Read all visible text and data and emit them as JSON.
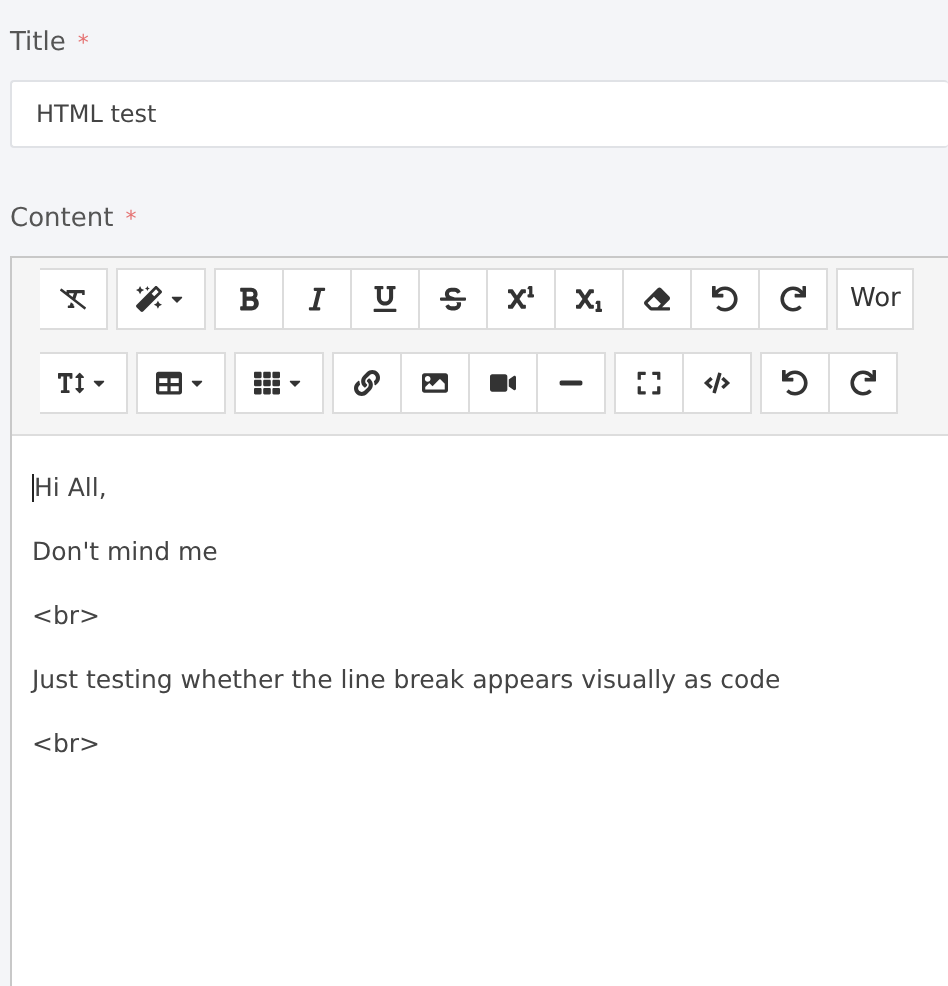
{
  "title_field": {
    "label": "Title",
    "required_mark": "*",
    "value": "HTML test"
  },
  "content_field": {
    "label": "Content",
    "required_mark": "*"
  },
  "toolbar": [
    [
      {
        "buttons": [
          {
            "kind": "clearformat",
            "dropdown": false
          }
        ]
      },
      {
        "buttons": [
          {
            "kind": "magic",
            "dropdown": true
          }
        ]
      },
      {
        "buttons": [
          {
            "kind": "bold",
            "dropdown": false
          },
          {
            "kind": "italic",
            "dropdown": false
          },
          {
            "kind": "underline",
            "dropdown": false
          },
          {
            "kind": "strike",
            "dropdown": false
          },
          {
            "kind": "superscript",
            "dropdown": false
          },
          {
            "kind": "subscript",
            "dropdown": false
          },
          {
            "kind": "eraser",
            "dropdown": false
          },
          {
            "kind": "undo",
            "dropdown": false
          },
          {
            "kind": "redo",
            "dropdown": false
          }
        ]
      },
      {
        "buttons": [
          {
            "kind": "text",
            "label": "Wor"
          }
        ]
      }
    ],
    [
      {
        "buttons": [
          {
            "kind": "textheight",
            "dropdown": true
          }
        ]
      },
      {
        "buttons": [
          {
            "kind": "table",
            "dropdown": true
          }
        ]
      },
      {
        "buttons": [
          {
            "kind": "grid",
            "dropdown": true
          }
        ]
      },
      {
        "buttons": [
          {
            "kind": "link",
            "dropdown": false
          },
          {
            "kind": "image",
            "dropdown": false
          },
          {
            "kind": "video",
            "dropdown": false
          },
          {
            "kind": "rule",
            "dropdown": false
          }
        ]
      },
      {
        "buttons": [
          {
            "kind": "fullscreen",
            "dropdown": false
          },
          {
            "kind": "code",
            "dropdown": false
          }
        ]
      },
      {
        "buttons": [
          {
            "kind": "undo",
            "dropdown": false
          },
          {
            "kind": "redo",
            "dropdown": false
          }
        ]
      }
    ]
  ],
  "body": {
    "cursor": true,
    "paragraphs": [
      "Hi All,",
      "Don't mind me",
      "<br>",
      "Just testing whether the line break appears visually as code",
      "<br>"
    ]
  }
}
